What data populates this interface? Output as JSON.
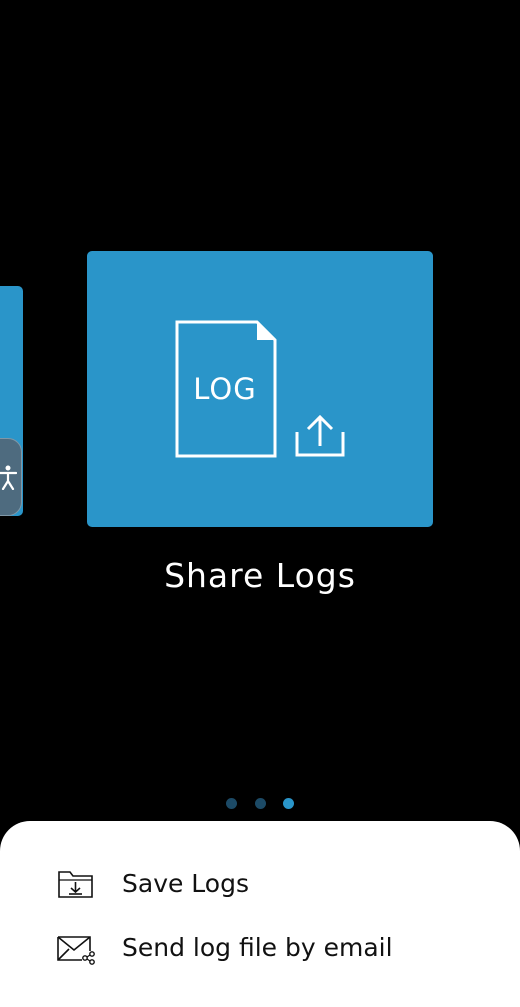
{
  "carousel": {
    "current_card": {
      "title": "Share Logs",
      "graphic_text": "LOG",
      "icon": "share-log-icon",
      "color": "#2a95c9"
    },
    "pager": {
      "total": 3,
      "active_index": 2,
      "active_color": "#2a95c9",
      "inactive_color": "#1c4a66"
    }
  },
  "accessibility_handle": {
    "icon": "accessibility-icon"
  },
  "sheet": {
    "items": [
      {
        "label": "Save Logs",
        "icon": "folder-download-icon"
      },
      {
        "label": "Send log file by email",
        "icon": "email-share-icon"
      }
    ]
  }
}
